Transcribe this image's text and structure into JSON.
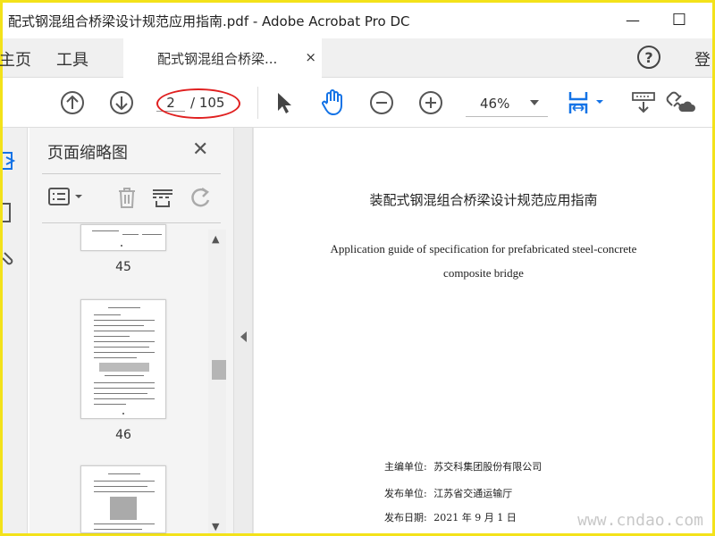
{
  "window": {
    "title": "配式钢混组合桥梁设计规范应用指南.pdf - Adobe Acrobat Pro DC",
    "minimize_label": "—",
    "maximize_label": "☐"
  },
  "menubar": {
    "home": "主页",
    "tools": "工具",
    "doc_tab": "配式钢混组合桥梁...",
    "doc_tab_close": "×",
    "signin": "登"
  },
  "toolbar": {
    "current_page": "2",
    "total_pages": "/ 105",
    "zoom": "46%"
  },
  "panel": {
    "title": "页面缩略图",
    "close": "✕",
    "thumbnails": [
      {
        "label": "45"
      },
      {
        "label": "46"
      }
    ]
  },
  "document": {
    "cn_title": "装配式钢混组合桥梁设计规范应用指南",
    "en_title_line1": "Application guide of specification for prefabricated steel-concrete",
    "en_title_line2": "composite bridge",
    "editor_label": "主编单位:",
    "editor_value": "苏交科集团股份有限公司",
    "publisher_label": "发布单位:",
    "publisher_value": "江苏省交通运输厅",
    "date_label": "发布日期:",
    "date_value": "2021 年 9 月 1 日"
  },
  "watermark": "www.cndao.com",
  "colors": {
    "accent_blue": "#1473e6",
    "annotation_red": "#e02020",
    "frame_yellow": "#f3e21a"
  }
}
